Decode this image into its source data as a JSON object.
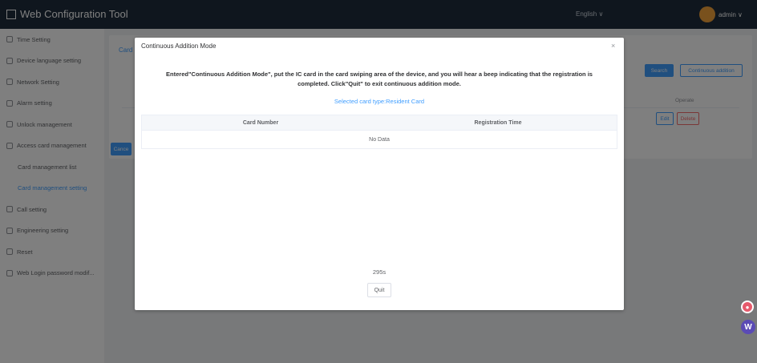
{
  "app": {
    "title": "Web Configuration Tool",
    "language": "English ∨",
    "user": "admin ∨"
  },
  "sidebar": {
    "items": [
      {
        "label": "Time Setting"
      },
      {
        "label": "Device language setting"
      },
      {
        "label": "Network Setting"
      },
      {
        "label": "Alarm setting"
      },
      {
        "label": "Unlock management"
      },
      {
        "label": "Access card management"
      },
      {
        "label": "Card management list"
      },
      {
        "label": "Card management setting"
      },
      {
        "label": "Call setting"
      },
      {
        "label": "Engineering setting"
      },
      {
        "label": "Reset"
      },
      {
        "label": "Web Login password modif..."
      }
    ]
  },
  "main": {
    "tab": "Card M",
    "buttons": {
      "primary": "Search",
      "continuous": "Continuous addition",
      "edit": "Edit",
      "delete": "Delete",
      "side": "Cance"
    },
    "operate_header": "Operate"
  },
  "dialog": {
    "title": "Continuous Addition Mode",
    "close": "×",
    "message": "Entered\"Continuous Addition Mode\", put the IC card in the card swiping area of the device, and you will hear a beep indicating that the registration is completed. Click\"Quit\" to exit continuous addition mode.",
    "card_type": "Selected card type:Resident Card",
    "table": {
      "headers": [
        "Card Number",
        "Registration Time"
      ],
      "empty_text": "No Data"
    },
    "countdown": "295s",
    "quit_label": "Quit"
  }
}
